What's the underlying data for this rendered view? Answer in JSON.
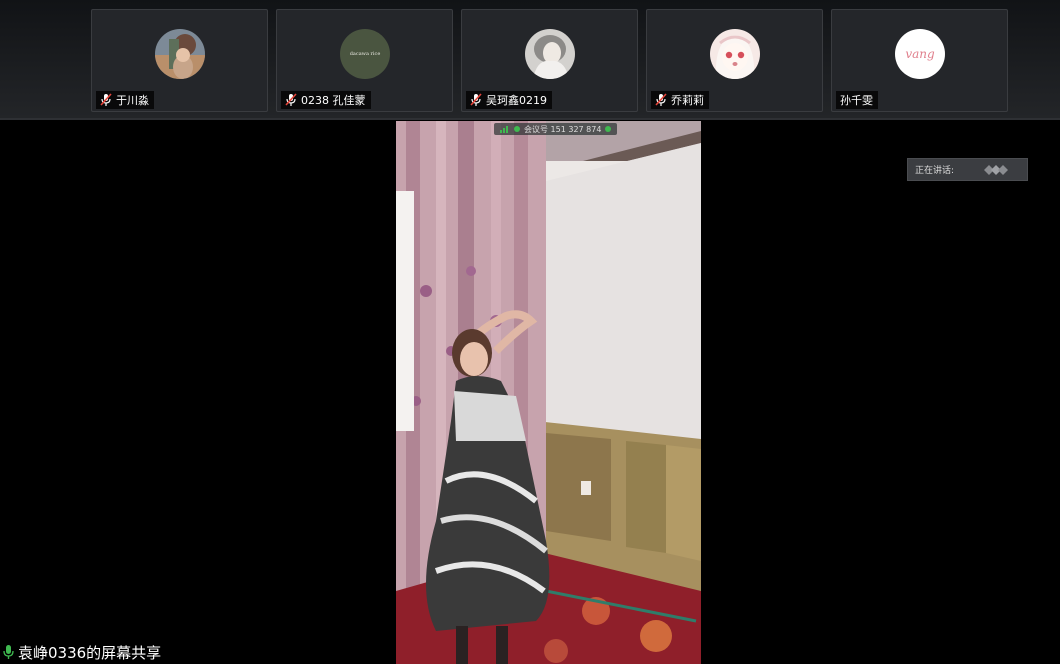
{
  "participants": [
    {
      "name": "于川淼",
      "avatar": "photo-avatar",
      "muted": true
    },
    {
      "name": "0238 孔佳蒙",
      "avatar": "text-avatar",
      "avatar_text": "dacawa rice",
      "muted": true
    },
    {
      "name": "吴珂鑫0219",
      "avatar": "photo-avatar",
      "muted": true
    },
    {
      "name": "乔莉莉",
      "avatar": "anime-avatar",
      "muted": true
    },
    {
      "name": "孙千雯",
      "avatar": "text-avatar",
      "avatar_text": "vang",
      "muted": false
    }
  ],
  "video": {
    "meeting_id": "会议号 151 327 874"
  },
  "speaking": {
    "label": "正在讲话:"
  },
  "share": {
    "label": "袁峥0336的屏幕共享"
  },
  "colors": {
    "background": "#000000",
    "strip": "#1c1e21",
    "tile": "#24262a",
    "mute_red": "#e5453a",
    "indicator_green": "#3fb950"
  }
}
